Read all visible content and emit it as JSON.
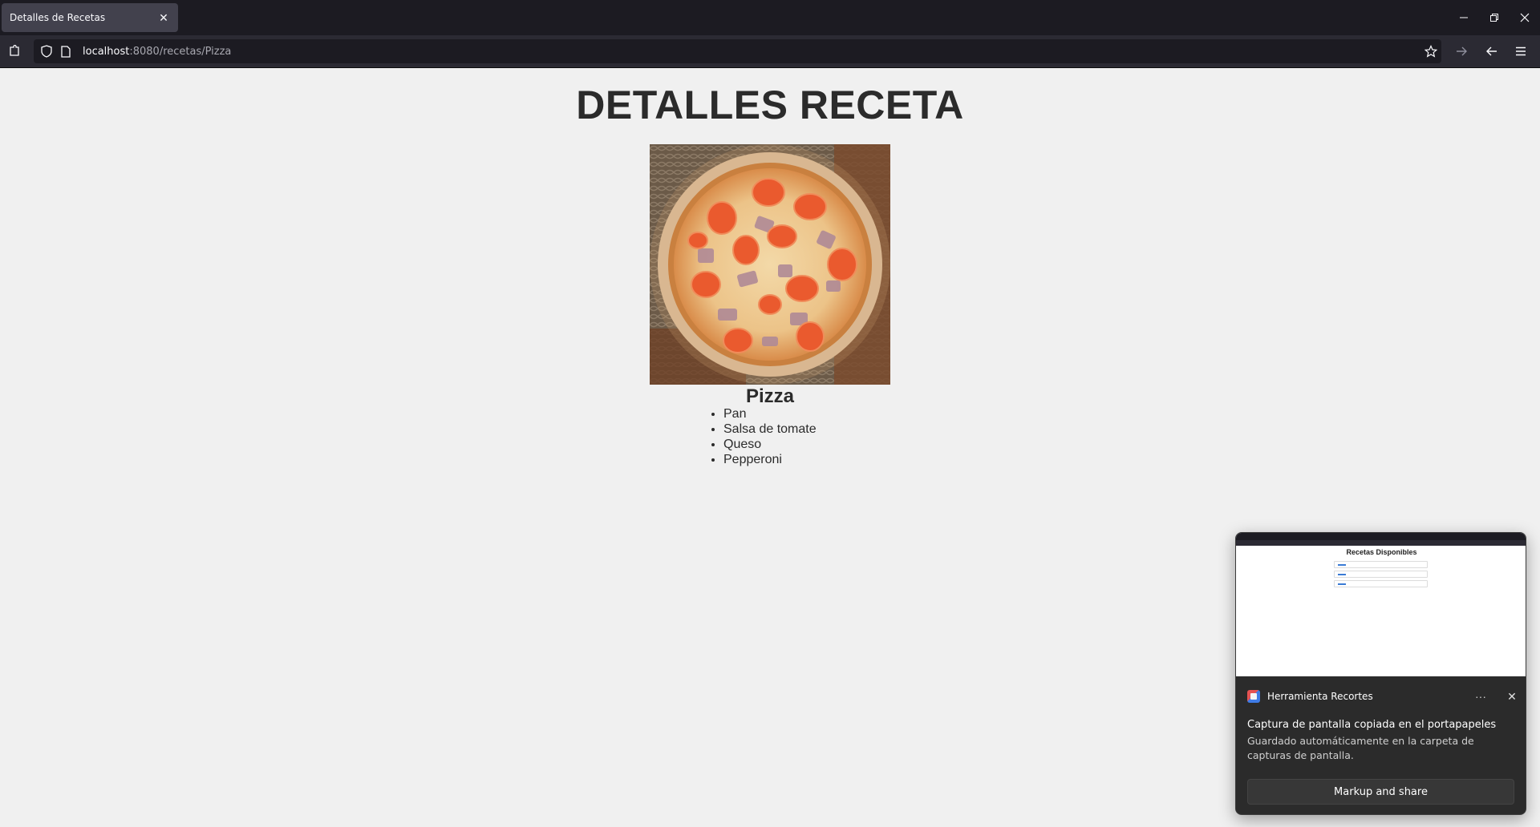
{
  "browser": {
    "tab_title": "Detalles de Recetas",
    "tab_close_icon": "close-icon",
    "url_host": "localhost",
    "url_rest": ":8080/recetas/Pizza",
    "icons": {
      "site_info": "shield-icon",
      "page": "page-icon",
      "bookmark": "star-icon",
      "forward": "arrow-right-icon",
      "back": "arrow-left-icon",
      "menu": "hamburger-icon",
      "extension": "puzzle-icon"
    }
  },
  "page": {
    "title": "DETALLES RECETA",
    "recipe_name": "Pizza",
    "image_alt": "pizza",
    "ingredients": [
      "Pan",
      "Salsa de tomate",
      "Queso",
      "Pepperoni"
    ]
  },
  "toast": {
    "preview_title": "Recetas Disponibles",
    "app_name": "Herramienta Recortes",
    "more_label": "···",
    "heading": "Captura de pantalla copiada en el portapapeles",
    "body": "Guardado automáticamente en la carpeta de capturas de pantalla.",
    "button_label": "Markup and share"
  },
  "colors": {
    "page_background": "#f0f0f0",
    "title_text": "#2b2b2b",
    "chrome_dark": "#1c1b22",
    "toolbar": "#2b2a33",
    "toast_background": "#2b2b2b"
  }
}
